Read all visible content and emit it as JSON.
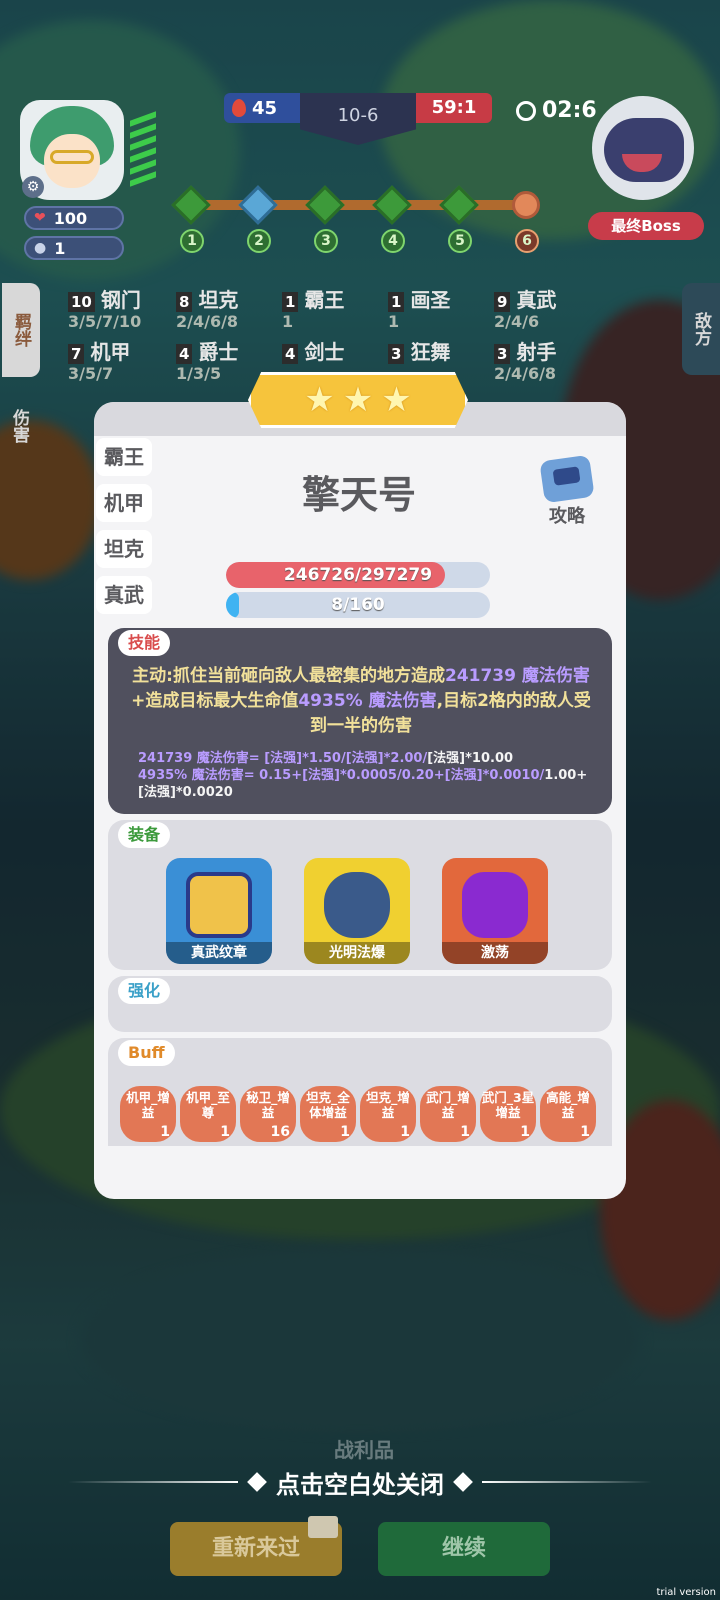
{
  "hud": {
    "hp": "100",
    "coins": "1",
    "score_left": "45",
    "round": "10-6",
    "score_right": "59:1",
    "timer": "02:6",
    "boss_label": "最终Boss",
    "stages": [
      "1",
      "2",
      "3",
      "4",
      "5",
      "6"
    ]
  },
  "side_tabs": {
    "bond": "羁绊",
    "damage": "伤害",
    "enemy": "敌方"
  },
  "traits": [
    {
      "count": "10",
      "name": "钢门",
      "levels": "3/5/7/10"
    },
    {
      "count": "8",
      "name": "坦克",
      "levels": "2/4/6/8"
    },
    {
      "count": "1",
      "name": "霸王",
      "levels": "1"
    },
    {
      "count": "1",
      "name": "画圣",
      "levels": "1"
    },
    {
      "count": "9",
      "name": "真武",
      "levels": "2/4/6"
    },
    {
      "count": "7",
      "name": "机甲",
      "levels": "3/5/7"
    },
    {
      "count": "4",
      "name": "爵士",
      "levels": "1/3/5"
    },
    {
      "count": "4",
      "name": "剑士",
      "levels": ""
    },
    {
      "count": "3",
      "name": "狂舞",
      "levels": ""
    },
    {
      "count": "3",
      "name": "射手",
      "levels": "2/4/6/8"
    }
  ],
  "panel": {
    "stars": [
      "★",
      "★",
      "★"
    ],
    "title": "擎天号",
    "heroes": [
      "霸王",
      "机甲",
      "坦克",
      "真武"
    ],
    "guide": "攻略",
    "hp_text": "246726/297279",
    "hp_ratio": 0.83,
    "mana_text": "8/160",
    "mana_ratio": 0.05,
    "skill": {
      "tag": "技能",
      "part1": "主动:抓住当前砸向敌人最密集的地方造成",
      "hl1": "241739 魔法伤害",
      "part2": "+造成目标最大生命值",
      "hl2": "4935% 魔法伤害",
      "part3": ",目标2格内的敌人受到一半的伤害",
      "formula1": "241739 魔法伤害= [法强]*1.50/[法强]*2.00/",
      "formula1_w": "[法强]*10.00",
      "formula2": "4935% 魔法伤害= 0.15+[法强]*0.0005/0.20+[法强]*0.0010/",
      "formula2_w": "1.00+[法强]*0.0020"
    },
    "equip": {
      "tag": "装备",
      "items": [
        "真武纹章",
        "光明法爆",
        "激荡"
      ]
    },
    "enhance_tag": "强化",
    "buff": {
      "tag": "Buff",
      "items": [
        {
          "name": "机甲_增益",
          "n": "1"
        },
        {
          "name": "机甲_至尊",
          "n": "1"
        },
        {
          "name": "秘卫_增益",
          "n": "16"
        },
        {
          "name": "坦克_全体增益",
          "n": "1"
        },
        {
          "name": "坦克_增益",
          "n": "1"
        },
        {
          "name": "武门_增益",
          "n": "1"
        },
        {
          "name": "武门_3星增益",
          "n": "1"
        },
        {
          "name": "高能_增益",
          "n": "1"
        }
      ]
    }
  },
  "bottom": {
    "spoils": "战利品",
    "close_hint": "点击空白处关闭",
    "retry": "重新来过",
    "continue": "继续",
    "trial": "trial version"
  },
  "colors": {
    "hp_fill": "#e8636b",
    "mana_fill": "#3fb3f2",
    "accent_star": "#f6c43c",
    "buff": "#e27755"
  }
}
